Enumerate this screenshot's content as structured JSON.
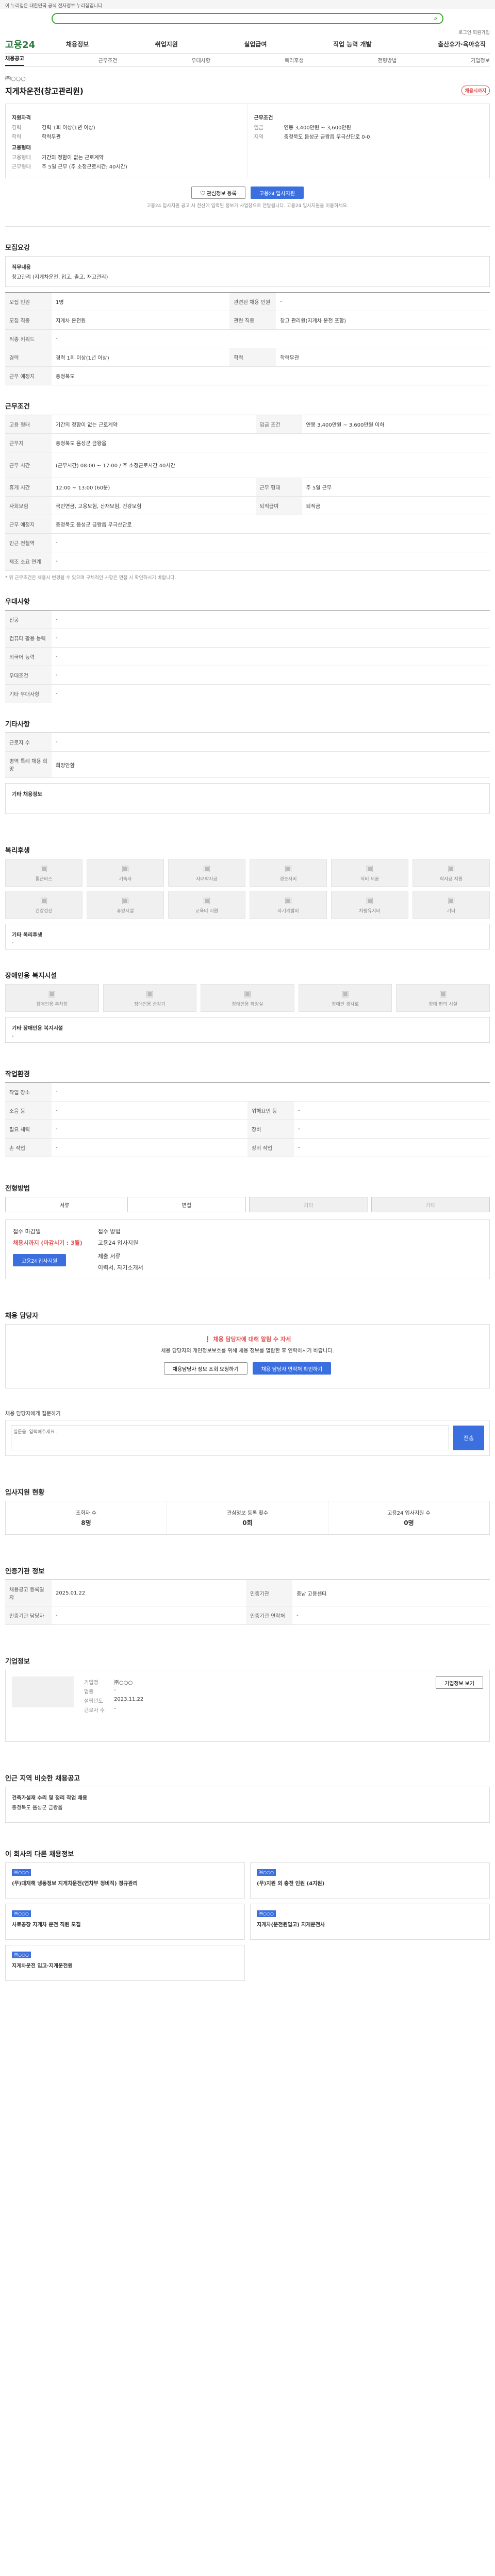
{
  "gov_bar": "이 누리집은 대한민국 공식 전자정부 누리집입니다.",
  "search": {
    "placeholder": ""
  },
  "util": "로그인  회원가입",
  "logo": "고용24",
  "gnb": [
    "채용정보",
    "취업지원",
    "실업급여",
    "직업 능력 개발",
    "출산휴가·육아휴직"
  ],
  "tabs": [
    "채용공고",
    "근무조건",
    "우대사항",
    "복리후생",
    "전형방법",
    "기업정보"
  ],
  "head": {
    "company": "㈜○○○",
    "title": "지게차운전(창고관리원)",
    "badge": "채용시까지"
  },
  "summary": {
    "left_title": "지원자격",
    "left": [
      {
        "k": "경력",
        "v": "경력 1회 이상(1년 이상)"
      },
      {
        "k": "학력",
        "v": "학력무관"
      }
    ],
    "left_title2": "고용형태",
    "left2": [
      {
        "k": "고용형태",
        "v": "기간의 정함이 없는 근로계약"
      },
      {
        "k": "근무형태",
        "v": "주 5일 근무 (주 소정근로시간: 40시간)"
      }
    ],
    "right_title": "근무조건",
    "right": [
      {
        "k": "임금",
        "v": "연봉 3,400만원 ~ 3,600만원"
      },
      {
        "k": "지역",
        "v": "충청북도 음성군 금왕읍 무극산단로 0-0"
      }
    ]
  },
  "buttons": {
    "save": "관심정보 등록",
    "apply": "고용24 입사지원"
  },
  "notice": "고용24 입사지원 공고 시 전산에 입력된 정보가 사업장으로 전달됩니다. 고용24 입사지원을 이용하세요.",
  "sections": {
    "job": "모집요강",
    "cond": "근무조건",
    "pref": "우대사항",
    "etc": "기타사항",
    "welfare": "복리후생",
    "disabled": "장애인용 복지시설",
    "env": "작업환경",
    "method": "전형방법",
    "contact": "채용 담당자",
    "stat": "입사지원 현황",
    "info": "인증기관 정보",
    "company": "기업정보",
    "similar": "인근 지역 비슷한 채용공고",
    "other": "이 회사의 다른 채용정보"
  },
  "job": {
    "card_title": "직무내용",
    "card_text": "창고관리 (지게차운전, 입고, 출고, 재고관리)",
    "rows": [
      {
        "k": "모집 인원",
        "v": "1명",
        "k2": "관련된 채용 인원",
        "v2": "-"
      },
      {
        "k": "모집 직종",
        "v": "지게차 운전원",
        "k2": "관련 직종",
        "v2": "창고 관리원(지게차 운전 포함)"
      },
      {
        "k": "직종 키워드",
        "v": "-",
        "k2": "",
        "v2": ""
      },
      {
        "k": "경력",
        "v": "경력 1회 이상(1년 이상)",
        "k2": "학력",
        "v2": "학력무관"
      },
      {
        "k": "근무 예정지",
        "v": "충청북도",
        "k2": "",
        "v2": ""
      }
    ]
  },
  "cond": {
    "rows": [
      {
        "k": "고용 형태",
        "v": "기간의 정함이 없는 근로계약",
        "k2": "임금 조건",
        "v2": "연봉 3,400만원 ~ 3,600만원 이하"
      },
      {
        "k": "근무지",
        "v": "충청북도 음성군 금왕읍",
        "k2": "",
        "v2": ""
      },
      {
        "k": "근무 시간",
        "v": "(근무시간) 08:00 ~ 17:00 / 주 소정근로시간 40시간",
        "k2": "",
        "v2": ""
      },
      {
        "k": "휴게 시간",
        "v": "12:00 ~ 13:00 (60분)",
        "k2": "근무 형태",
        "v2": "주 5일 근무"
      },
      {
        "k": "사회보험",
        "v": "국민연금, 고용보험, 산재보험, 건강보험",
        "k2": "퇴직급여",
        "v2": "퇴직금"
      },
      {
        "k": "근무 예정지",
        "v": "충청북도 음성군 금왕읍 무극산단로",
        "k2": "",
        "v2": ""
      },
      {
        "k": "인근 전철역",
        "v": "-",
        "k2": "",
        "v2": ""
      },
      {
        "k": "제조 소요 연계",
        "v": "-",
        "k2": "",
        "v2": ""
      }
    ],
    "footnote": "* 위 근무조건은 채용시 변경될 수 있으며 구체적인 사항은 면접 시 확인하시기 바랍니다."
  },
  "pref": {
    "rows": [
      {
        "k": "전공",
        "v": "-"
      },
      {
        "k": "컴퓨터 활용 능력",
        "v": "-"
      },
      {
        "k": "외국어 능력",
        "v": "-"
      },
      {
        "k": "우대조건",
        "v": "-"
      },
      {
        "k": "기타 우대사항",
        "v": "-"
      }
    ]
  },
  "etc": {
    "rows": [
      {
        "k": "근로자 수",
        "v": "-"
      },
      {
        "k": "병역 특례 채용 희망",
        "v": "희망안함"
      }
    ],
    "card_title": "기타 채용정보"
  },
  "welfare": {
    "icons": [
      "통근버스",
      "기숙사",
      "자녀학자금",
      "경조사비",
      "식비 제공",
      "학자금 지원",
      "건강검진",
      "휴양시설",
      "교육비 지원",
      "자기계발비",
      "차량유지비",
      "기타"
    ],
    "etc_title": "기타 복리후생",
    "etc_text": "-"
  },
  "disabled": {
    "icons": [
      "장애인용 주차장",
      "장애인용 승강기",
      "장애인용 화장실",
      "장애인 경사로",
      "장애 편의 시설"
    ],
    "etc_title": "기타 장애인용 복지시설",
    "etc_text": "-"
  },
  "env": {
    "rows": [
      {
        "k": "작업 장소",
        "v": "-",
        "k2": "",
        "v2": ""
      },
      {
        "k": "소음 등",
        "v": "-",
        "k2": "위해요인 등",
        "v2": "-"
      },
      {
        "k": "필요 체력",
        "v": "-",
        "k2": "장비",
        "v2": "-"
      },
      {
        "k": "손 작업",
        "v": "-",
        "k2": "장비 작업",
        "v2": "-"
      }
    ]
  },
  "method": {
    "steps": [
      "서류",
      "면접",
      "기타",
      "기타"
    ],
    "left_label": "접수 마감일",
    "left_value": "채용시까지 (마감시기 : 3월)",
    "right_label": "접수 방법",
    "right_value": "고용24 입사지원",
    "doc_label": "제출 서류",
    "doc_value": "이력서, 자기소개서",
    "apply": "고용24 입사지원"
  },
  "contact": {
    "title": "채용 담당자에 대해 알림 수 자세",
    "text": "채용 담당자의 개인정보보호를 위해 채용 정보를 열람한 후 연락하시기 바랍니다.",
    "btn1": "채용담당자 정보 조회 요청하기",
    "btn2": "채용 담당자 연락처 확인하기"
  },
  "inquiry": {
    "label": "채용 담당자에게 질문하기",
    "placeholder": "질문을 입력해주세요.",
    "button": "전송"
  },
  "stat": {
    "items": [
      {
        "label": "조회자 수",
        "value": "8명"
      },
      {
        "label": "관심정보 등록 횟수",
        "value": "0회"
      },
      {
        "label": "고용24 입사지원 수",
        "value": "0명"
      }
    ]
  },
  "info": {
    "rows": [
      {
        "k": "채용공고 등록일자",
        "v": "2025.01.22",
        "k2": "인증기관",
        "v2": "충남 고용센터"
      },
      {
        "k": "인증기관 담당자",
        "v": "-",
        "k2": "인증기관 연락처",
        "v2": "-"
      }
    ]
  },
  "company": {
    "rows": [
      {
        "k": "기업명",
        "v": "㈜○○○"
      },
      {
        "k": "업종",
        "v": "-"
      },
      {
        "k": "설립년도",
        "v": "2023.11.22"
      },
      {
        "k": "근로자 수",
        "v": "-"
      }
    ],
    "btn": "기업정보 보기"
  },
  "similar": {
    "title": "건축가설재 수리 및 정리 작업 채용",
    "text": "충청북도 음성군 금왕읍"
  },
  "other": [
    {
      "tag": "㈜○○○",
      "title": "(무)대재해 냉동정보 지게차운전(연차부 정비직) 정규관리"
    },
    {
      "tag": "㈜○○○",
      "title": "(무)지원 외 충전 인원 (4지원)"
    },
    {
      "tag": "㈜○○○",
      "title": "사료공장 지게차 운전 직원 모집"
    },
    {
      "tag": "㈜○○○",
      "title": "지게차(운전원입고) 지게운전사"
    },
    {
      "tag": "㈜○○○",
      "title": "지게차운전 입고·지게운전원"
    }
  ]
}
